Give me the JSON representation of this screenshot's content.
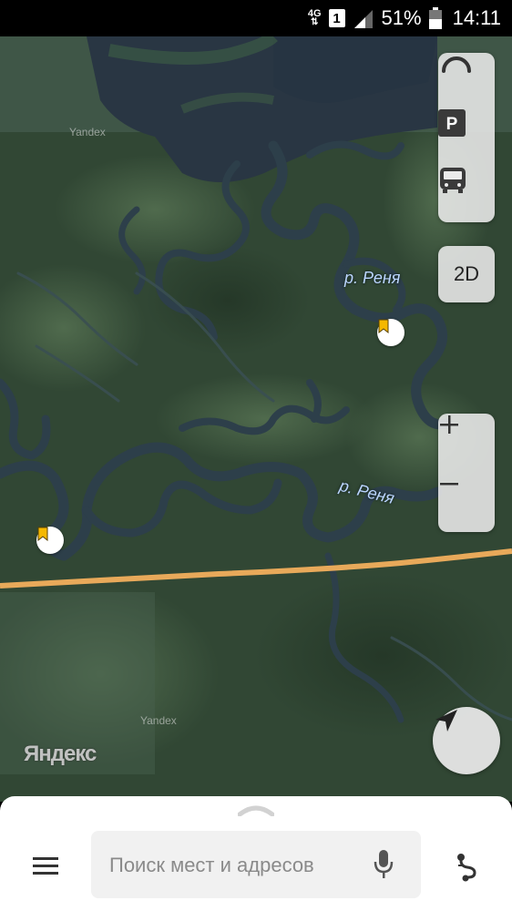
{
  "status_bar": {
    "network": "4G",
    "sim": "1",
    "battery_percent": "51%",
    "time": "14:11"
  },
  "map": {
    "mode_button_label": "2D",
    "river_labels": [
      "р. Реня",
      "р. Реня"
    ],
    "watermarks": [
      "Yandex",
      "Yandex"
    ],
    "logo_text": "Яндекс",
    "road_color": "#e8a95a",
    "river_color": "#2d3f4a"
  },
  "controls": {
    "icons": [
      "spinner-icon",
      "parking-icon",
      "bus-icon",
      "zoom-in-icon",
      "zoom-out-icon",
      "location-arrow-icon"
    ]
  },
  "bottom_bar": {
    "search_placeholder": "Поиск мест и адресов",
    "icons": [
      "menu-icon",
      "microphone-icon",
      "route-icon",
      "chevron-up-icon"
    ]
  }
}
